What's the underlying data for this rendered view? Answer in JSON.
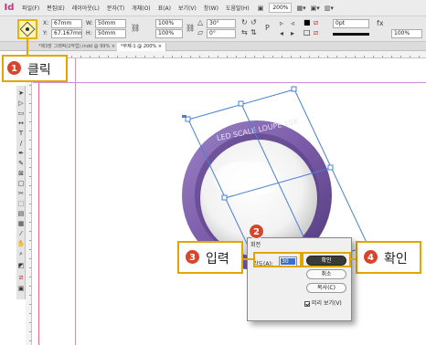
{
  "app": {
    "logo": "Id",
    "menu": [
      "파일(F)",
      "편집(E)",
      "레이아웃(L)",
      "문자(T)",
      "개체(O)",
      "표(A)",
      "보기(V)",
      "창(W)",
      "도움말(H)"
    ],
    "zoom": "200%"
  },
  "control_panel": {
    "x_label": "X:",
    "x_value": "67mm",
    "y_label": "Y:",
    "y_value": "67.167mm",
    "w_label": "W:",
    "w_value": "50mm",
    "h_label": "H:",
    "h_value": "50mm",
    "scale_x": "100%",
    "scale_y": "100%",
    "angle": "30°",
    "shear": "0°",
    "stroke_weight": "0pt",
    "opacity": "100%"
  },
  "tabs": [
    {
      "label": "*제3장 그래픽(2작업).indd @ 99% ×"
    },
    {
      "label": "*무제-1 @ 200% ×"
    }
  ],
  "object": {
    "text": "LED SCALE LOUPE 10X",
    "ring_color": "#7a5aa8"
  },
  "callouts": {
    "step1": {
      "num": "1",
      "text": "클릭"
    },
    "step2": {
      "num": "2"
    },
    "step3": {
      "num": "3",
      "text": "입력"
    },
    "step4": {
      "num": "4",
      "text": "확인"
    }
  },
  "dialog": {
    "title": "회전",
    "angle_label": "각도(A):",
    "angle_value": "30",
    "ok": "확인",
    "cancel": "취소",
    "copy": "복사(C)",
    "preview": "미리 보기(V)"
  },
  "colors": {
    "badge": "#d9442a",
    "highlight": "#e2a600",
    "selection": "#4a7fd8"
  }
}
